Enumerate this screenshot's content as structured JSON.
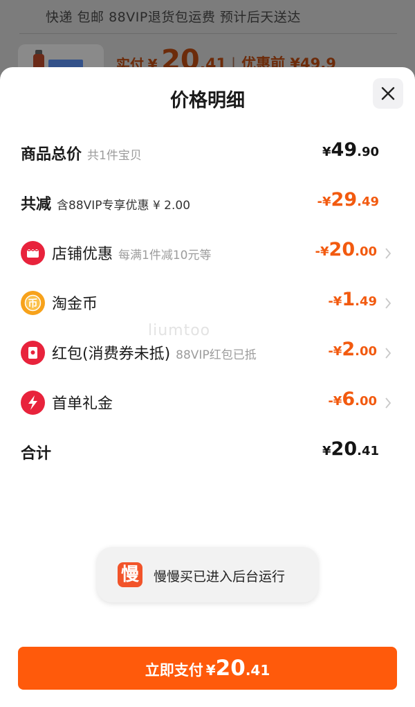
{
  "background": {
    "shipping_info": "快递 包邮 88VIP退货包运费 预计后天送达",
    "actual_pay_label": "实付",
    "actual_pay_currency": "¥",
    "actual_pay_int": "20",
    "actual_pay_dec": ".41",
    "pre_discount": "优惠前 ¥49.9"
  },
  "sheet": {
    "title": "价格明细",
    "rows": [
      {
        "title": "商品总价",
        "sub": "共1件宝贝",
        "cur": "¥",
        "int": "49",
        "dec": ".90"
      },
      {
        "title": "共减",
        "sub": "含88VIP专享优惠 ¥ 2.00",
        "cur": "-¥",
        "int": "29",
        "dec": ".49"
      },
      {
        "title": "店铺优惠",
        "sub": "每满1件减10元等",
        "cur": "-¥",
        "int": "20",
        "dec": ".00",
        "icon": "shop-icon"
      },
      {
        "title": "淘金币",
        "sub": "",
        "cur": "-¥",
        "int": "1",
        "dec": ".49",
        "icon": "coin-icon"
      },
      {
        "title": "红包(消费券未抵)",
        "sub": "88VIP红包已抵",
        "cur": "-¥",
        "int": "2",
        "dec": ".00",
        "icon": "red-packet-icon"
      },
      {
        "title": "首单礼金",
        "sub": "",
        "cur": "-¥",
        "int": "6",
        "dec": ".00",
        "icon": "lightning-icon"
      },
      {
        "title": "合计",
        "sub": "",
        "cur": "¥",
        "int": "20",
        "dec": ".41"
      }
    ],
    "watermark": "liumtoo"
  },
  "toast": {
    "icon_text": "慢",
    "message": "慢慢买已进入后台运行"
  },
  "pay_button": {
    "label": "立即支付",
    "cur": "¥",
    "int": "20",
    "dec": ".41"
  },
  "colors": {
    "accent": "#ff5a0b",
    "discount": "#f25a0f",
    "shop_icon": "#e8233c",
    "coin_icon": "#f7a21b",
    "red_packet_icon": "#e8233c",
    "lightning_icon": "#e8233c"
  }
}
